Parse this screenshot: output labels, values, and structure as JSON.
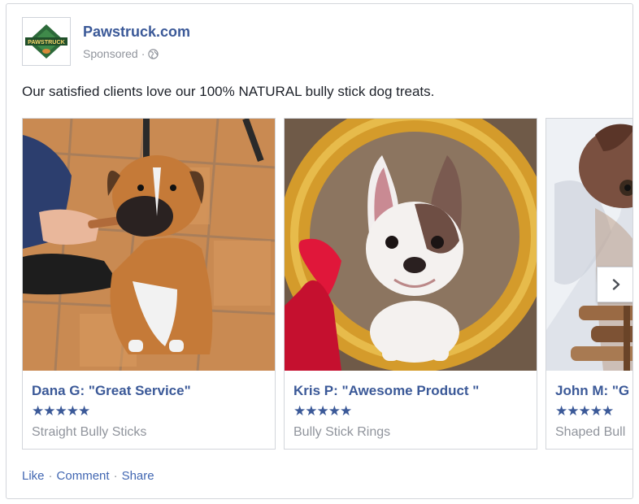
{
  "page": {
    "name": "Pawstruck.com",
    "logo_text": "PAWSTRUCK",
    "sponsored": "Sponsored",
    "separator": "·",
    "audience_icon": "globe-icon"
  },
  "post": {
    "text": "Our satisfied clients love our 100% NATURAL bully stick dog treats."
  },
  "carousel": {
    "next_icon": "chevron-right-icon",
    "cards": [
      {
        "title": "Dana G: \"Great Service\"",
        "stars": "★★★★★",
        "rating": 5,
        "subtitle": "Straight Bully Sticks"
      },
      {
        "title": "Kris P: \"Awesome Product \"",
        "stars": "★★★★★",
        "rating": 5,
        "subtitle": "Bully Stick Rings"
      },
      {
        "title": "John M: \"G",
        "stars": "★★★★★",
        "rating": 5,
        "subtitle": "Shaped Bull"
      }
    ]
  },
  "actions": {
    "like": "Like",
    "comment": "Comment",
    "share": "Share",
    "separator": "·"
  },
  "colors": {
    "link": "#3b5998",
    "muted": "#90949c",
    "text": "#1d2129",
    "border": "#d3d6db"
  }
}
